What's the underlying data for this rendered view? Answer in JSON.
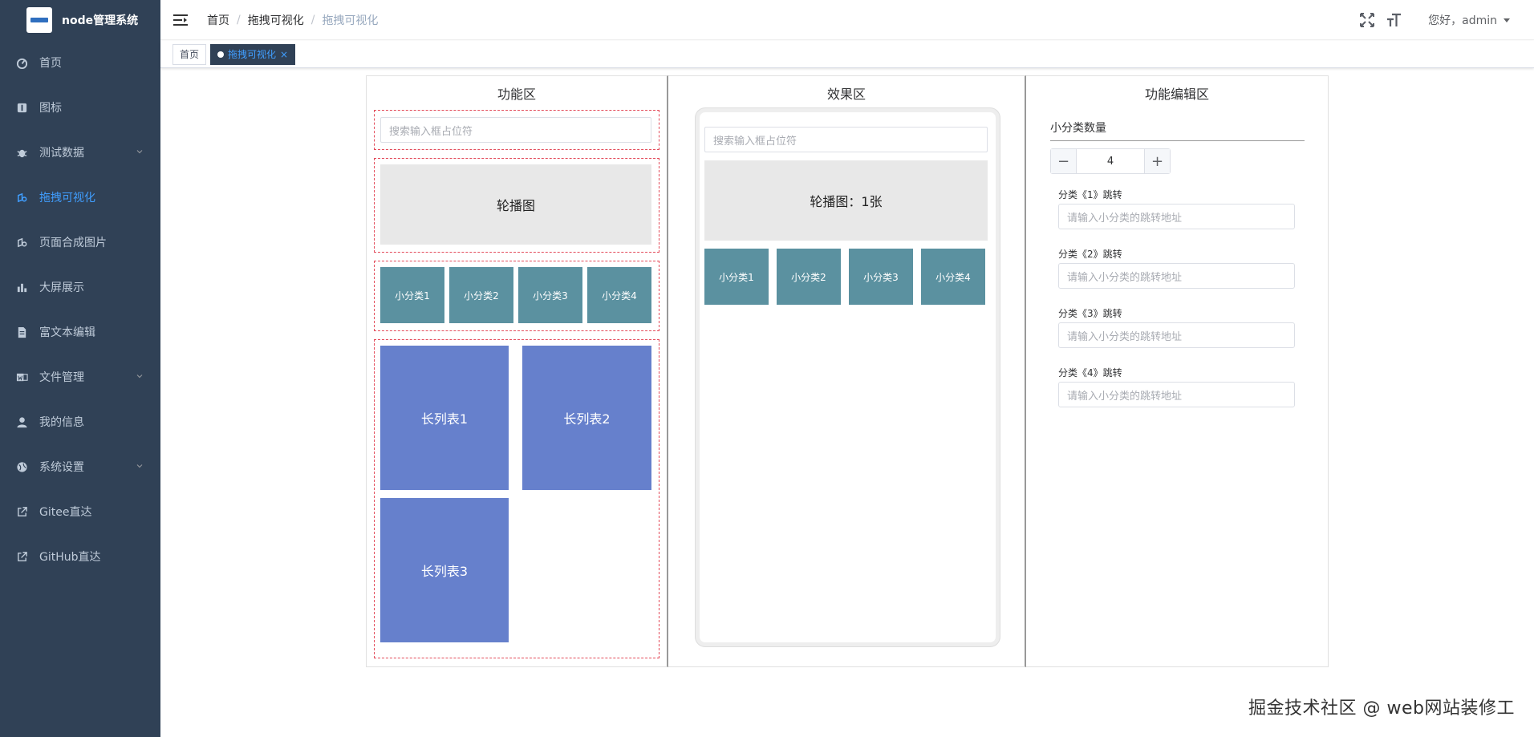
{
  "app": {
    "title": "node管理系统"
  },
  "sidebar": {
    "items": [
      {
        "label": "首页",
        "icon": "dashboard-icon",
        "active": false,
        "has_arrow": false
      },
      {
        "label": "图标",
        "icon": "icon-icon",
        "active": false,
        "has_arrow": false
      },
      {
        "label": "测试数据",
        "icon": "bug-icon",
        "active": false,
        "has_arrow": true
      },
      {
        "label": "拖拽可视化",
        "icon": "drag-icon",
        "active": true,
        "has_arrow": false
      },
      {
        "label": "页面合成图片",
        "icon": "drag-icon",
        "active": false,
        "has_arrow": false
      },
      {
        "label": "大屏展示",
        "icon": "chart-icon",
        "active": false,
        "has_arrow": false
      },
      {
        "label": "富文本编辑",
        "icon": "document-icon",
        "active": false,
        "has_arrow": false
      },
      {
        "label": "文件管理",
        "icon": "word-icon",
        "active": false,
        "has_arrow": true
      },
      {
        "label": "我的信息",
        "icon": "user-icon",
        "active": false,
        "has_arrow": false
      },
      {
        "label": "系统设置",
        "icon": "globe-icon",
        "active": false,
        "has_arrow": true
      },
      {
        "label": "Gitee直达",
        "icon": "external-link-icon",
        "active": false,
        "has_arrow": false
      },
      {
        "label": "GitHub直达",
        "icon": "external-link-icon",
        "active": false,
        "has_arrow": false
      }
    ]
  },
  "navbar": {
    "breadcrumb": [
      "首页",
      "拖拽可视化",
      "拖拽可视化"
    ],
    "greeting": "您好，admin"
  },
  "tags": [
    {
      "label": "首页",
      "active": false
    },
    {
      "label": "拖拽可视化",
      "active": true
    }
  ],
  "function_area": {
    "title": "功能区",
    "search_placeholder": "搜索输入框占位符",
    "carousel_label": "轮播图",
    "categories": [
      "小分类1",
      "小分类2",
      "小分类3",
      "小分类4"
    ],
    "long_lists": [
      "长列表1",
      "长列表2",
      "长列表3"
    ]
  },
  "effect_area": {
    "title": "效果区",
    "search_placeholder": "搜索输入框占位符",
    "carousel_label": "轮播图：1张",
    "categories": [
      "小分类1",
      "小分类2",
      "小分类3",
      "小分类4"
    ]
  },
  "edit_area": {
    "title": "功能编辑区",
    "count_label": "小分类数量",
    "count_value": "4",
    "fields": [
      {
        "label": "分类《1》跳转",
        "placeholder": "请输入小分类的跳转地址"
      },
      {
        "label": "分类《2》跳转",
        "placeholder": "请输入小分类的跳转地址"
      },
      {
        "label": "分类《3》跳转",
        "placeholder": "请输入小分类的跳转地址"
      },
      {
        "label": "分类《4》跳转",
        "placeholder": "请输入小分类的跳转地址"
      }
    ]
  },
  "watermark": "掘金技术社区 @ web网站装修工",
  "colors": {
    "sidebar_bg": "#304156",
    "active": "#409eff",
    "category": "#5b91a0",
    "long_list": "#6680cc",
    "dashed_border": "#e34b5a"
  }
}
